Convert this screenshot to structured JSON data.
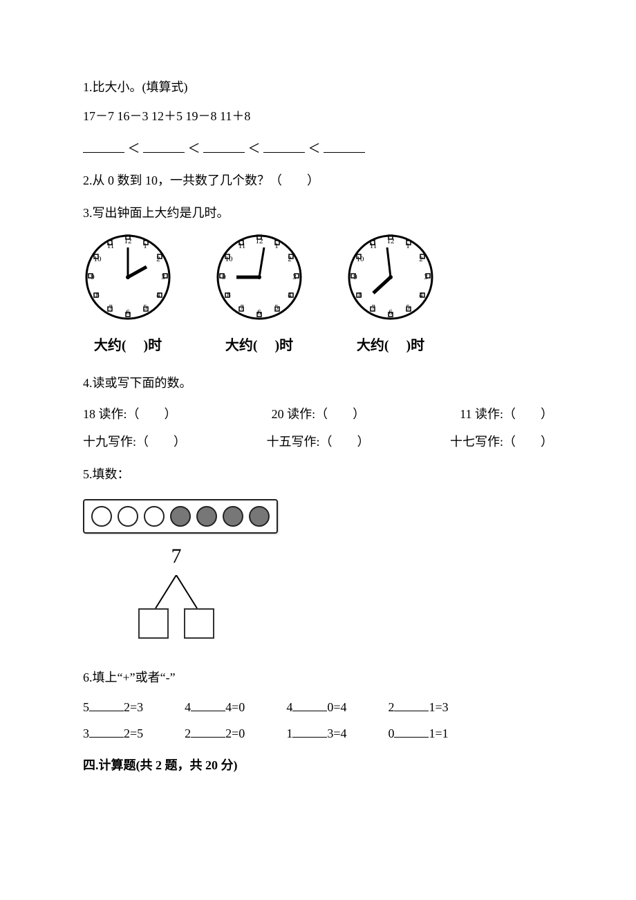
{
  "q1": {
    "prompt": "1.比大小。(填算式)",
    "exprs": "17－7 16－3 12＋5 19－8 11＋8",
    "lt": "＜"
  },
  "q2": {
    "text": "2.从 0 数到 10，一共数了几个数？（　　）"
  },
  "q3": {
    "prompt": "3.写出钟面上大约是几时。",
    "caption": "大约(　 )时"
  },
  "q4": {
    "prompt": "4.读或写下面的数。",
    "read": [
      {
        "label": "18 读作:（　　）"
      },
      {
        "label": "20 读作:（　　）"
      },
      {
        "label": "11 读作:（　　）"
      }
    ],
    "write": [
      {
        "label": "十九写作:（　　）"
      },
      {
        "label": "十五写作:（　　）"
      },
      {
        "label": "十七写作:（　　）"
      }
    ]
  },
  "q5": {
    "prompt": "5.填数：",
    "total": "7"
  },
  "q6": {
    "prompt": "6.填上“+”或者“-”",
    "cells": [
      [
        "5",
        "2=3"
      ],
      [
        "4",
        "4=0"
      ],
      [
        "4",
        "0=4"
      ],
      [
        "2",
        "1=3"
      ],
      [
        "3",
        "2=5"
      ],
      [
        "2",
        "2=0"
      ],
      [
        "1",
        "3=4"
      ],
      [
        "0",
        "1=1"
      ]
    ]
  },
  "sec4": "四.计算题(共 2 题，共 20 分)"
}
